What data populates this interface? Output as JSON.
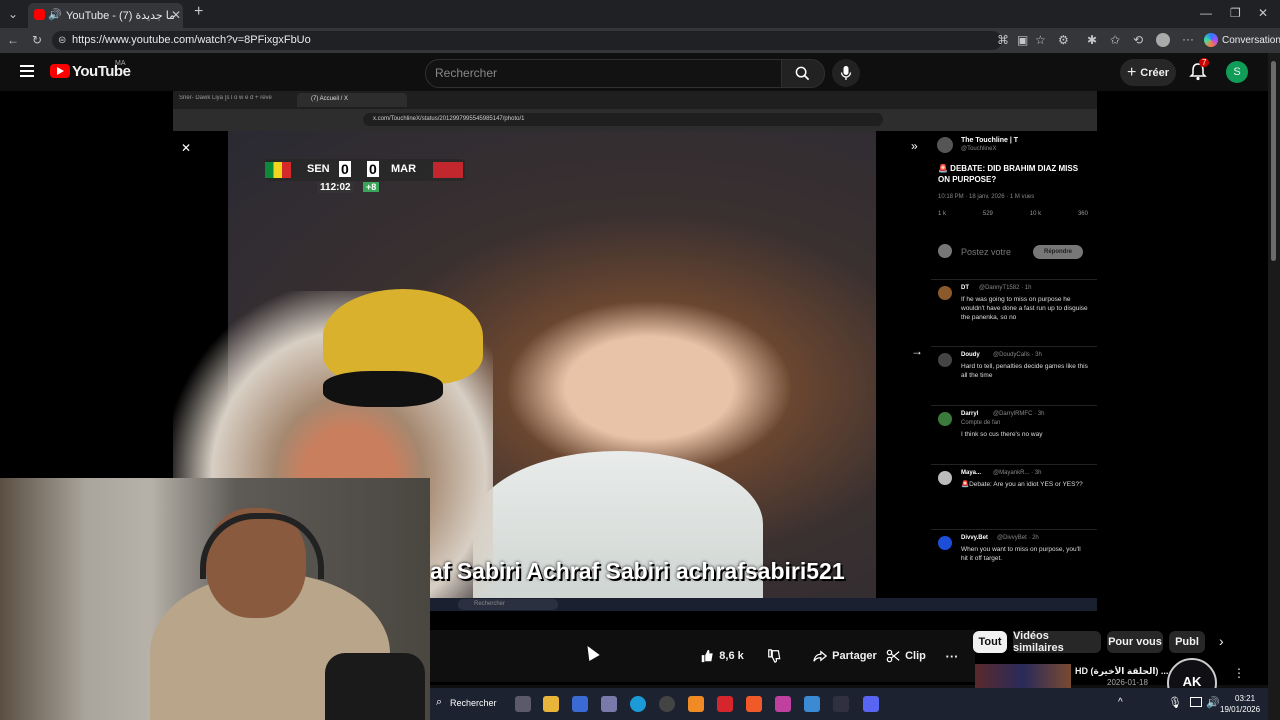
{
  "browser": {
    "tab_title": "YouTube - (7) تا حاجة ما جديدة",
    "url": "https://www.youtube.com/watch?v=8PFixgxFbUo",
    "conversation_label": "Conversation"
  },
  "youtube": {
    "logo_text": "YouTube",
    "region": "MA",
    "search_placeholder": "Rechercher",
    "create_label": "Créer",
    "notif_count": "7",
    "avatar_letter": "S"
  },
  "video": {
    "inner_tabs": [
      "Sner- Dawk Liya [s l o w e d + reve",
      "(7) Accueil / X"
    ],
    "inner_url": "x.com/TouchlineX/status/2012997995545985147/photo/1",
    "scoreboard": {
      "home": "SEN",
      "home_score": "0",
      "away_score": "0",
      "away": "MAR",
      "time": "112:02",
      "extra": "+8"
    },
    "overlay_text": "af Sabiri  Achraf Sabiri  achrafsabiri521",
    "tweet": {
      "author": "The Touchline | T",
      "handle": "@TouchlineX",
      "text": "🚨 DEBATE: DID BRAHIM DIAZ MISS ON PURPOSE?",
      "meta": "10:18 PM · 18 janv. 2026 · 1 M vues",
      "stats": [
        "1 k",
        "529",
        "10 k",
        "360"
      ],
      "reply_placeholder": "Postez votre",
      "reply_btn": "Répondre"
    },
    "replies": [
      {
        "name": "DT",
        "handle": "@DannyT1582 · 1h",
        "text": "If he was going to miss on purpose he wouldn't have done a fast run up to disguise the panenka, so no",
        "stats": [
          "2",
          "",
          "17",
          "29 k"
        ]
      },
      {
        "name": "Doudy",
        "handle": "@DoudyCalls · 3h",
        "text": "Hard to tell, penalties decide games like this all the time",
        "stats": [
          "",
          "",
          "6",
          "39 k"
        ]
      },
      {
        "name": "Darryl",
        "handle": "@DarrylRMFC · 3h",
        "badge": "Compte de fan",
        "text": "I think so cus there's no way",
        "stats": [
          "3",
          "",
          "112",
          "90 k"
        ]
      },
      {
        "name": "Maya...",
        "handle": "@MayankR... · 3h",
        "text": "🚨Debate: Are you an idiot YES or YES??",
        "stats": [
          "6",
          "",
          "338",
          "66 k"
        ]
      },
      {
        "name": "Divvy.Bet",
        "handle": "@DivvyBet · 2h",
        "text": "When you want to miss on purpose, you'll hit it off target.",
        "stats": [
          "2",
          "",
          "116",
          "17 k"
        ]
      }
    ],
    "taskbar_search": "Rechercher"
  },
  "actions": {
    "likes": "8,6 k",
    "share": "Partager",
    "clip": "Clip"
  },
  "chips": [
    "Tout",
    "Vidéos similaires",
    "Pour vous",
    "Publ"
  ],
  "recommendation": {
    "title": "HD (الحلقة الأخيرة) ...",
    "date": "2026-01-18"
  },
  "taskbar": {
    "search": "Rechercher",
    "time": "03:21",
    "date": "19/01/2026",
    "ak_logo": "AK"
  },
  "colors": {
    "youtube_red": "#ff0000",
    "accent_blue": "#1d9bf0",
    "avatar_green": "#0f9d58"
  }
}
